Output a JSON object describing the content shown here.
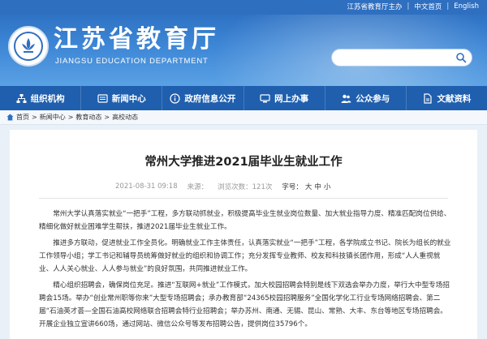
{
  "top_links": {
    "site_link": "江苏省教育厅主办",
    "chinese": "中文首页",
    "english": "English"
  },
  "header": {
    "title": "江苏省教育厅",
    "subtitle": "JIANGSU EDUCATION DEPARTMENT",
    "search_placeholder": ""
  },
  "nav": {
    "items": [
      {
        "label": "组织机构",
        "icon": "org-icon"
      },
      {
        "label": "新闻中心",
        "icon": "news-icon"
      },
      {
        "label": "政府信息公开",
        "icon": "info-icon"
      },
      {
        "label": "网上办事",
        "icon": "service-icon"
      },
      {
        "label": "公众参与",
        "icon": "people-icon"
      },
      {
        "label": "文献资料",
        "icon": "docs-icon"
      }
    ]
  },
  "breadcrumb": [
    "首页",
    "新闻中心",
    "教育动态",
    "高校动态"
  ],
  "article": {
    "title": "常州大学推进2021届毕业生就业工作",
    "date": "2021-08-31 09:18",
    "source": "来源：",
    "views": "浏览次数：121次",
    "font_size_label": "字号：",
    "size_large": "大",
    "size_medium": "中",
    "size_small": "小",
    "paragraphs": [
      "常州大学认真落实就业“一把手”工程，多方联动抓就业，积极提高毕业生就业岗位数量、加大就业指导力度、精准匹配岗位供给、精细化做好就业困难学生帮扶，推进2021届毕业生就业工作。",
      "推进多方联动，促进就业工作全员化。明确就业工作主体责任，认真落实就业“一把手”工程，各学院成立书记、院长为组长的就业工作领导小组；学工书记和辅导员统筹做好就业的组织和协调工作；充分发挥专业教师、校友和科技镇长团作用，形成“人人重视就业、人人关心就业、人人参与就业”的良好氛围，共同推进就业工作。",
      "精心组织招聘会，确保岗位充足。推进“互联网+就业”工作模式，加大校园招聘会特别是线下双选会举办力度，举行大中型专场招聘会15场。举办“创业常州职等你来”大型专场招聘会；承办教育部“24365校园招聘服务”全国化学化工行业专场网络招聘会、第二届“石油英才荟—全国石油高校网络联合招聘会特行业招聘会；举办苏州、南通、无锡、昆山、常熟、大丰、东台等地区专场招聘会。开展企业独立宣讲660场，通过网站、微信公众号等发布招聘公告，提供岗位35796个。"
    ]
  }
}
